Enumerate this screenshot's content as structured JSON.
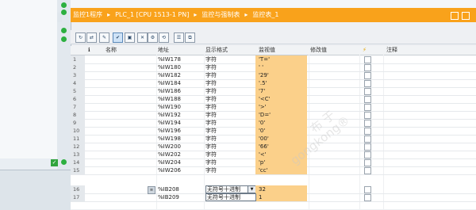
{
  "breadcrumb": [
    "监控1程序",
    "PLC_1 [CPU 1513-1 PN]",
    "监控与强制表",
    "监控表_1"
  ],
  "toolbar_icons": [
    "monitor-all-icon",
    "monitor-once-icon",
    "modify-icon",
    "modify-now-icon",
    "force-icon",
    "force-stop-icon",
    "display-icon",
    "chart-icon",
    "goto-icon",
    "clone-icon"
  ],
  "columns": {
    "name": "名称",
    "address": "地址",
    "format": "显示格式",
    "monitor": "监视值",
    "modify": "修改值",
    "comment": "注释"
  },
  "rows": [
    {
      "n": "1",
      "address": "%IW178",
      "format": "字符",
      "value": "'T='"
    },
    {
      "n": "2",
      "address": "%IW180",
      "format": "字符",
      "value": "' '"
    },
    {
      "n": "3",
      "address": "%IW182",
      "format": "字符",
      "value": "'29'"
    },
    {
      "n": "4",
      "address": "%IW184",
      "format": "字符",
      "value": "'.5'"
    },
    {
      "n": "5",
      "address": "%IW186",
      "format": "字符",
      "value": "'7'"
    },
    {
      "n": "6",
      "address": "%IW188",
      "format": "字符",
      "value": "'<C'"
    },
    {
      "n": "7",
      "address": "%IW190",
      "format": "字符",
      "value": "'>'"
    },
    {
      "n": "8",
      "address": "%IW192",
      "format": "字符",
      "value": "'D='"
    },
    {
      "n": "9",
      "address": "%IW194",
      "format": "字符",
      "value": "'0'"
    },
    {
      "n": "10",
      "address": "%IW196",
      "format": "字符",
      "value": "'0'"
    },
    {
      "n": "11",
      "address": "%IW198",
      "format": "字符",
      "value": "'00'"
    },
    {
      "n": "12",
      "address": "%IW200",
      "format": "字符",
      "value": "'66'"
    },
    {
      "n": "13",
      "address": "%IW202",
      "format": "字符",
      "value": "'<'"
    },
    {
      "n": "14",
      "address": "%IW204",
      "format": "字符",
      "value": "'p'"
    },
    {
      "n": "15",
      "address": "%IW206",
      "format": "字符",
      "value": "'cc'"
    },
    {
      "n": "16",
      "address": "%IB208",
      "format": "无符号十进制",
      "value": "32",
      "dropdown": true
    },
    {
      "n": "17",
      "address": "%IB209",
      "format": "",
      "value": "1",
      "option": "无符号十进制"
    }
  ],
  "watermark": [
    "布 于",
    "gongkong®"
  ],
  "colors": {
    "accent": "#f9a21b",
    "monitor_bg": "#fbd08a",
    "status_green": "#2db040"
  }
}
